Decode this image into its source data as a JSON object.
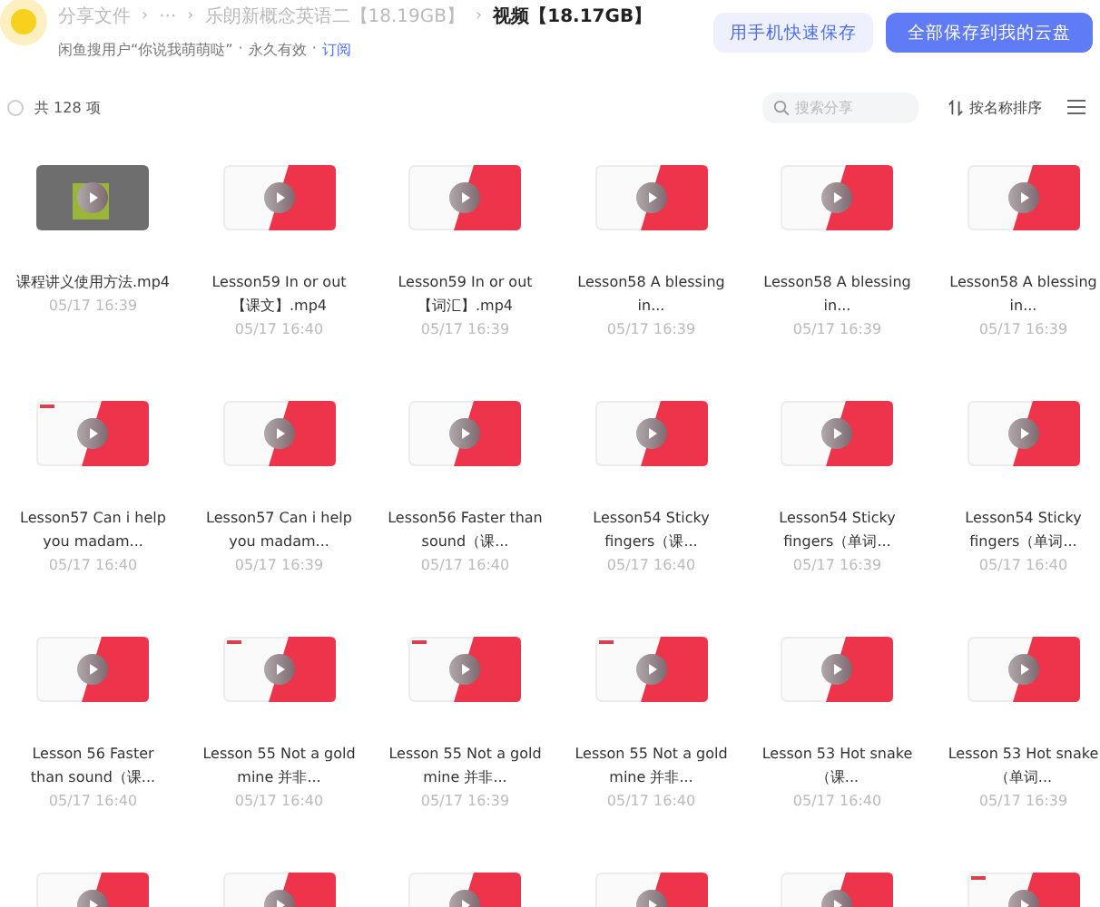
{
  "header": {
    "breadcrumb": [
      {
        "label": "分享文件",
        "current": false
      },
      {
        "separator": "›",
        "label": "···",
        "current": false
      },
      {
        "separator": "›",
        "label": "乐朗新概念英语二【18.19GB】",
        "current": false
      },
      {
        "separator": "›",
        "label": "视频【18.17GB】",
        "current": true
      }
    ],
    "info": [
      {
        "kind": "text",
        "text": "闲鱼搜用户“你说我萌萌哒”"
      },
      {
        "kind": "dot",
        "text": "·"
      },
      {
        "kind": "text",
        "text": "永久有效"
      },
      {
        "kind": "dot",
        "text": "·"
      },
      {
        "kind": "link",
        "text": "订阅"
      }
    ],
    "buttons": [
      {
        "label": "用手机快速保存",
        "kind": "secondary"
      },
      {
        "label": "全部保存到我的云盘",
        "kind": "primary"
      }
    ]
  },
  "toolbar": {
    "select_all": {
      "checked": false
    },
    "count": "共 128 项",
    "search": {
      "placeholder": "搜索分享"
    },
    "sort": "按名称排序"
  },
  "files": [
    {
      "kind": "photo",
      "logo": false,
      "name": "课程讲义使用方法.mp4",
      "date": "05/17 16:39"
    },
    {
      "kind": "video",
      "logo": false,
      "name": "Lesson59 In or out【课文】.mp4",
      "date": "05/17 16:40"
    },
    {
      "kind": "video",
      "logo": false,
      "name": "Lesson59 In or out【词汇】.mp4",
      "date": "05/17 16:39"
    },
    {
      "kind": "video",
      "logo": false,
      "name": "Lesson58 A blessing in...",
      "date": "05/17 16:39"
    },
    {
      "kind": "video",
      "logo": false,
      "name": "Lesson58 A blessing in...",
      "date": "05/17 16:39"
    },
    {
      "kind": "video",
      "logo": false,
      "name": "Lesson58 A blessing in...",
      "date": "05/17 16:39"
    },
    {
      "kind": "video",
      "logo": true,
      "name": "Lesson57 Can i help you madam...",
      "date": "05/17 16:40"
    },
    {
      "kind": "video",
      "logo": false,
      "name": "Lesson57 Can i help you madam...",
      "date": "05/17 16:39"
    },
    {
      "kind": "video",
      "logo": false,
      "name": "Lesson56 Faster than sound（课...",
      "date": "05/17 16:40"
    },
    {
      "kind": "video",
      "logo": false,
      "name": "Lesson54 Sticky fingers（课...",
      "date": "05/17 16:40"
    },
    {
      "kind": "video",
      "logo": false,
      "name": "Lesson54 Sticky fingers（单词...",
      "date": "05/17 16:39"
    },
    {
      "kind": "video",
      "logo": false,
      "name": "Lesson54 Sticky fingers（单词...",
      "date": "05/17 16:40"
    },
    {
      "kind": "video",
      "logo": false,
      "name": "Lesson 56 Faster than sound（课...",
      "date": "05/17 16:40"
    },
    {
      "kind": "video",
      "logo": true,
      "name": "Lesson 55 Not a gold mine 并非...",
      "date": "05/17 16:40"
    },
    {
      "kind": "video",
      "logo": true,
      "name": "Lesson 55 Not a gold mine 并非...",
      "date": "05/17 16:39"
    },
    {
      "kind": "video",
      "logo": true,
      "name": "Lesson 55 Not a gold mine 并非...",
      "date": "05/17 16:40"
    },
    {
      "kind": "video",
      "logo": false,
      "name": "Lesson 53 Hot snake（课...",
      "date": "05/17 16:40"
    },
    {
      "kind": "video",
      "logo": false,
      "name": "Lesson 53 Hot snake（单词...",
      "date": "05/17 16:39"
    },
    {
      "kind": "video",
      "logo": false
    },
    {
      "kind": "video",
      "logo": false
    },
    {
      "kind": "video",
      "logo": false
    },
    {
      "kind": "video",
      "logo": false
    },
    {
      "kind": "video",
      "logo": false
    },
    {
      "kind": "video",
      "logo": true
    }
  ]
}
